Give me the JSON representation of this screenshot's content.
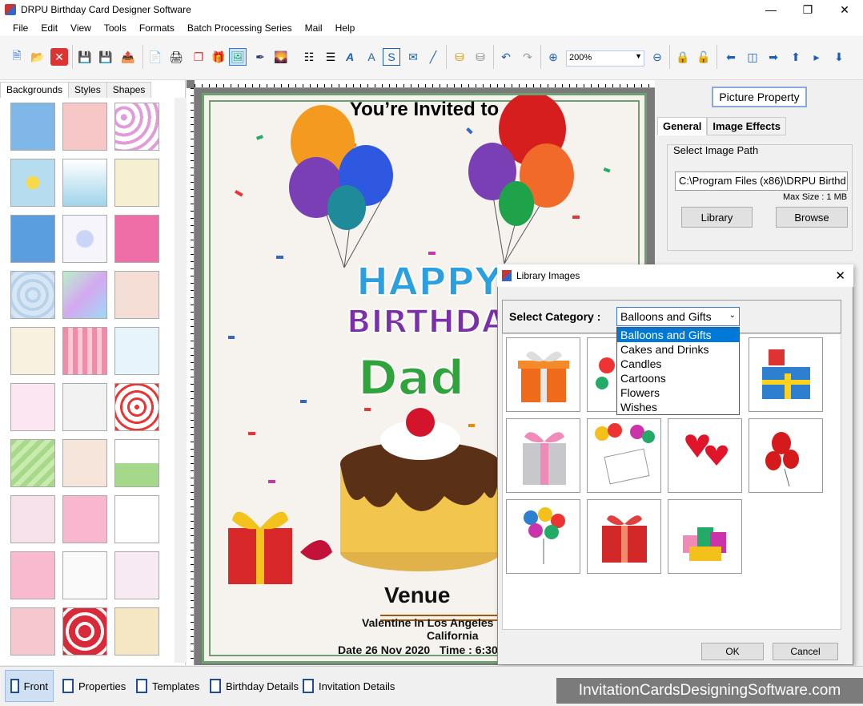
{
  "window": {
    "title": "DRPU Birthday Card Designer Software"
  },
  "menu": [
    "File",
    "Edit",
    "View",
    "Tools",
    "Formats",
    "Batch Processing Series",
    "Mail",
    "Help"
  ],
  "toolbar": {
    "zoom": "200%"
  },
  "left_tabs": [
    "Backgrounds",
    "Styles",
    "Shapes"
  ],
  "card": {
    "invited": "You’re Invited to",
    "happy": "HAPPY",
    "birthday": "BIRTHDA",
    "dad": "Dad",
    "venue": "Venue",
    "line1": "Valentine in Los Angeles",
    "line2": "California",
    "line3": "Date 26 Nov 2020   Time : 6:30"
  },
  "right_panel": {
    "title": "Picture Property",
    "tabs": [
      "General",
      "Image Effects"
    ],
    "group_label": "Select Image Path",
    "path": "C:\\Program Files (x86)\\DRPU Birthd",
    "max_size": "Max Size : 1 MB",
    "library_btn": "Library",
    "browse_btn": "Browse"
  },
  "dialog": {
    "title": "Library Images",
    "category_label": "Select Category :",
    "selected": "Balloons and Gifts",
    "options": [
      "Balloons and Gifts",
      "Cakes and Drinks",
      "Candles",
      "Cartoons",
      "Flowers",
      "Wishes"
    ],
    "ok": "OK",
    "cancel": "Cancel"
  },
  "bottom_tabs": [
    "Front",
    "Properties",
    "Templates",
    "Birthday Details",
    "Invitation Details"
  ],
  "brand": "InvitationCardsDesigningSoftware.com"
}
